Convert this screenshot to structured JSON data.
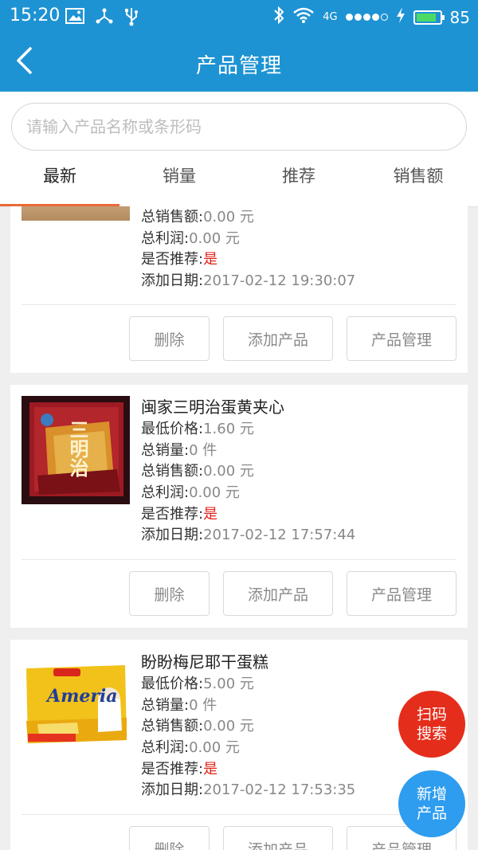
{
  "status_bar": {
    "time": "15:20",
    "network": "4G",
    "battery": "85",
    "icons_left": [
      "image-icon",
      "usb-share-icon",
      "usb-icon"
    ],
    "icons_right": [
      "bluetooth-icon",
      "wifi-icon",
      "signal-dots-icon",
      "charging-icon",
      "battery-icon"
    ]
  },
  "header": {
    "title": "产品管理",
    "back_icon": "chevron-left-icon"
  },
  "search": {
    "placeholder": "请输入产品名称或条形码"
  },
  "tabs": [
    {
      "label": "最新",
      "active": true
    },
    {
      "label": "销量",
      "active": false
    },
    {
      "label": "推荐",
      "active": false
    },
    {
      "label": "销售额",
      "active": false
    }
  ],
  "labels": {
    "min_price": "最低价格:",
    "total_sales": "总销量:",
    "total_revenue": "总销售额:",
    "total_profit": "总利润:",
    "recommended": "是否推荐:",
    "added_date": "添加日期:"
  },
  "buttons": {
    "delete": "删除",
    "add_product": "添加产品",
    "manage_product": "产品管理"
  },
  "products": [
    {
      "total_revenue": "0.00 元",
      "total_profit": "0.00 元",
      "recommended": "是",
      "added_date": "2017-02-12 19:30:07"
    },
    {
      "name": "闽家三明治蛋黄夹心",
      "min_price": "1.60 元",
      "total_sales": "0 件",
      "total_revenue": "0.00 元",
      "total_profit": "0.00 元",
      "recommended": "是",
      "added_date": "2017-02-12 17:57:44",
      "image_text": "三明治"
    },
    {
      "name": "盼盼梅尼耶干蛋糕",
      "min_price": "5.00 元",
      "total_sales": "0 件",
      "total_revenue": "0.00 元",
      "total_profit": "0.00 元",
      "recommended": "是",
      "added_date": "2017-02-12 17:53:35",
      "image_text": "Ameria"
    }
  ],
  "fabs": {
    "scan": [
      "扫码",
      "搜索"
    ],
    "new": [
      "新增",
      "产品"
    ]
  },
  "colors": {
    "primary": "#1e93d3",
    "accent_tab": "#e86a37",
    "recommend_red": "#e0231a",
    "fab_scan": "#e52d1b",
    "fab_new": "#2e9df0"
  }
}
